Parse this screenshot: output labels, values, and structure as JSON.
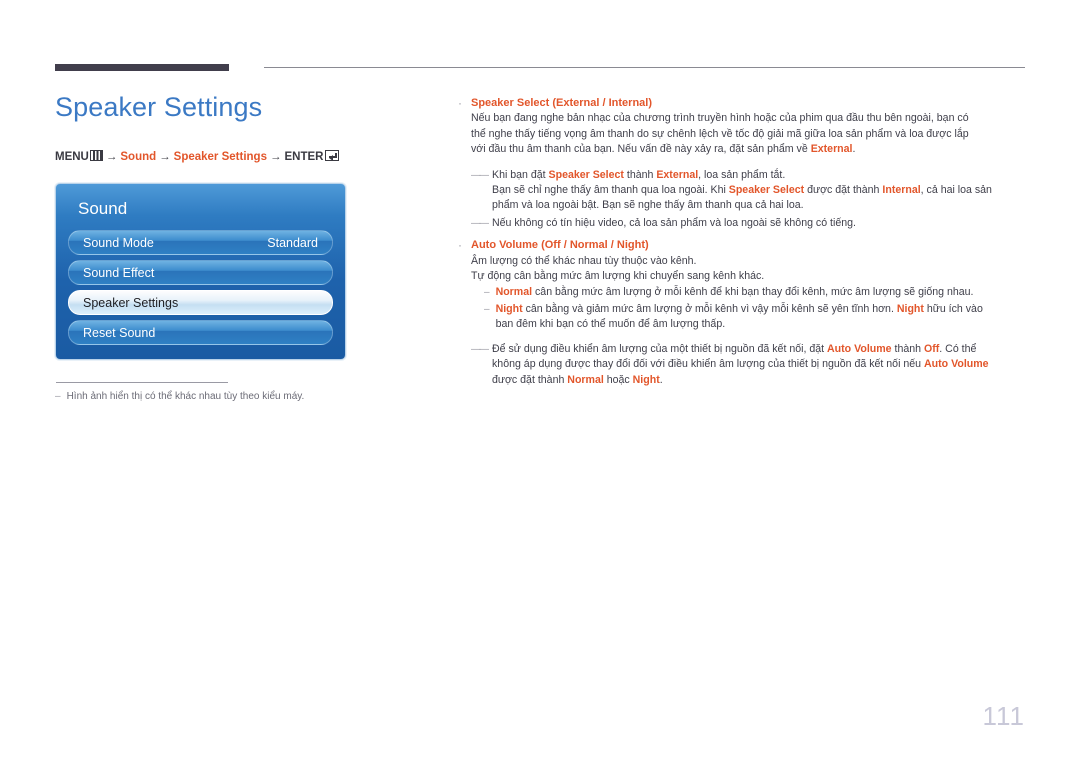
{
  "header": {
    "rule_color": "#413e4c"
  },
  "left": {
    "title": "Speaker Settings",
    "breadcrumb": {
      "menu_label": "MENU",
      "menu_icon": "menu-grid-icon",
      "arrow": "→",
      "item1": "Sound",
      "item2": "Speaker Settings",
      "enter_label": "ENTER",
      "enter_icon": "enter-return-icon"
    },
    "osd": {
      "title": "Sound",
      "rows": [
        {
          "label": "Sound Mode",
          "value": "Standard",
          "selected": false
        },
        {
          "label": "Sound Effect",
          "value": "",
          "selected": false
        },
        {
          "label": "Speaker Settings",
          "value": "",
          "selected": true
        },
        {
          "label": "Reset Sound",
          "value": "",
          "selected": false
        }
      ]
    },
    "footnote": {
      "dash": "–",
      "text": "Hình ảnh hiển thị có thể khác nhau tùy theo kiểu máy."
    }
  },
  "right": {
    "bullet_glyph": "·",
    "dash_glyph": "——",
    "sub_dash_glyph": "–",
    "section1": {
      "head_name": "Speaker Select",
      "head_paren_open": " (",
      "head_opt1": "External",
      "head_sep": " / ",
      "head_opt2": "Internal",
      "head_paren_close": ")",
      "body_l1_a": "Nếu bạn đang nghe bản nhạc của chương trình truyền hình hoặc của phim qua đầu thu bên ngoài, bạn có",
      "body_l2_a": "thể nghe thấy tiếng vọng âm thanh do sự chênh lệch về tốc độ giải mã giữa loa sản phẩm và loa được lắp",
      "body_l3_a": "với đầu thu âm thanh của bạn. Nếu vấn đề này xảy ra, đặt sản phẩm về ",
      "body_l3_accent": "External",
      "body_l3_end": "."
    },
    "note1": {
      "l1_a": "Khi bạn đặt ",
      "l1_b": "Speaker Select",
      "l1_c": " thành ",
      "l1_d": "External",
      "l1_e": ", loa sản phẩm tắt.",
      "l2_a": "Bạn sẽ chỉ nghe thấy âm thanh qua loa ngoài. Khi ",
      "l2_b": "Speaker Select",
      "l2_c": " được đặt thành ",
      "l2_d": "Internal",
      "l2_e": ", cả hai loa sản",
      "l3_a": "phẩm và loa ngoài bật. Bạn sẽ nghe thấy âm thanh qua cả hai loa."
    },
    "note2": {
      "text": "Nếu không có tín hiệu video, cả loa sản phẩm và loa ngoài sẽ không có tiếng."
    },
    "section2": {
      "head_name": "Auto Volume",
      "head_paren_open": " (",
      "head_opt1": "Off",
      "head_sep1": " / ",
      "head_opt2": "Normal",
      "head_sep2": " / ",
      "head_opt3": "Night",
      "head_paren_close": ")",
      "body_l1": "Âm lượng có thể khác nhau tùy thuộc vào kênh.",
      "body_l2": "Tự động cân bằng mức âm lượng khi chuyển sang kênh khác."
    },
    "sub1": {
      "term": "Normal",
      "text": " cân bằng mức âm lượng ở mỗi kênh để khi bạn thay đổi kênh, mức âm lượng sẽ giống nhau."
    },
    "sub2": {
      "term": "Night",
      "l1_a": " cân bằng và giảm mức âm lượng ở mỗi kênh vì vậy mỗi kênh sẽ yên tĩnh hơn. ",
      "l1_b": "Night",
      "l1_c": " hữu ích vào",
      "l2": "ban đêm khi bạn có thể muốn để âm lượng thấp."
    },
    "note3": {
      "l1_a": "Để sử dụng điều khiển âm lượng của một thiết bị nguồn đã kết nối, đặt ",
      "l1_b": "Auto Volume",
      "l1_c": " thành ",
      "l1_d": "Off",
      "l1_e": ". Có thể",
      "l2_a": "không áp dụng được thay đổi đối với điều khiển âm lượng của thiết bị nguồn đã kết nối nếu ",
      "l2_b": "Auto Volume",
      "l3_a": "được đặt thành ",
      "l3_b": "Normal",
      "l3_c": " hoặc ",
      "l3_d": "Night",
      "l3_e": "."
    }
  },
  "page_number": "111",
  "colors": {
    "accent_orange": "#e2562b",
    "title_blue": "#3b79c4",
    "rule_dark": "#413e4c",
    "page_num_gray": "#c8c8d8"
  }
}
